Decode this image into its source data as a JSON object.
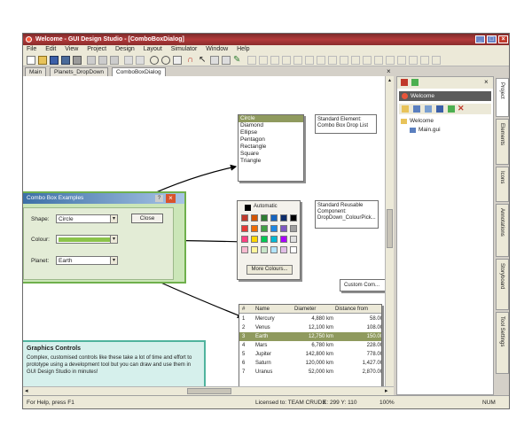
{
  "window": {
    "title": "Welcome - GUI Design Studio - [ComboBoxDialog]"
  },
  "menu": [
    "File",
    "Edit",
    "View",
    "Project",
    "Design",
    "Layout",
    "Simulator",
    "Window",
    "Help"
  ],
  "tabs": [
    "Main",
    "Planets_DropDown",
    "ComboBoxDialog"
  ],
  "shape_list": {
    "items": [
      "Circle",
      "Diamond",
      "Ellipse",
      "Pentagon",
      "Rectangle",
      "Square",
      "Triangle"
    ],
    "selected_index": 0
  },
  "callouts": {
    "standard": "Standard Element: Combo Box Drop List",
    "reusable": "Standard Reusable Component: DropDown_ColourPick...",
    "custom": "Custom Com..."
  },
  "colour_picker": {
    "automatic_label": "Automatic",
    "more_button": "More Colours...",
    "colors": [
      "#c0392b",
      "#d35400",
      "#2e7d32",
      "#1565c0",
      "#0d2d6b",
      "#000000",
      "#e53935",
      "#ef6c00",
      "#43a047",
      "#1e88e5",
      "#7e57c2",
      "#9e9e9e",
      "#ff4081",
      "#ffd600",
      "#00c853",
      "#00b8d4",
      "#aa00ff",
      "#e0e0e0",
      "#f8bbd0",
      "#fff59d",
      "#c8e6c9",
      "#b3e5fc",
      "#e1bee7",
      "#ffffff"
    ]
  },
  "dialog": {
    "title": "Combo Box Examples",
    "shape_label": "Shape:",
    "shape_value": "Circle",
    "colour_label": "Colour:",
    "colour_value": "#8bc34a",
    "planet_label": "Planet:",
    "planet_value": "Earth",
    "close_button": "Close"
  },
  "planets_table": {
    "headers": [
      "#",
      "Name",
      "Diameter",
      "Distance from"
    ],
    "rows": [
      [
        "1",
        "Mercury",
        "4,880 km",
        "58.00"
      ],
      [
        "2",
        "Venus",
        "12,100 km",
        "108.00"
      ],
      [
        "3",
        "Earth",
        "12,750 km",
        "150.00"
      ],
      [
        "4",
        "Mars",
        "6,780 km",
        "228.00"
      ],
      [
        "5",
        "Jupiter",
        "142,800 km",
        "778.00"
      ],
      [
        "6",
        "Saturn",
        "120,000 km",
        "1,427.00"
      ],
      [
        "7",
        "Uranus",
        "52,000 km",
        "2,870.00"
      ]
    ],
    "selected_index": 2
  },
  "info_box": {
    "title": "Graphics Controls",
    "text": "Complex, customised controls like these take a lot of time and effort to prototype using a development tool but you can draw and use them in GUI Design Studio in minutes!"
  },
  "panel": {
    "welcome_tab": "Welcome",
    "tree_root": "Welcome",
    "tree_child": "Main.gui"
  },
  "side_tabs": [
    "Project",
    "Elements",
    "Icons",
    "Annotations",
    "Storyboard",
    "Tool Settings"
  ],
  "status": {
    "help": "For Help, press F1",
    "license": "Licensed to: TEAM CRUDE",
    "coords": "X: 299 Y: 110",
    "zoom": "100%",
    "num": "NUM"
  },
  "accent": "#c85a3a"
}
